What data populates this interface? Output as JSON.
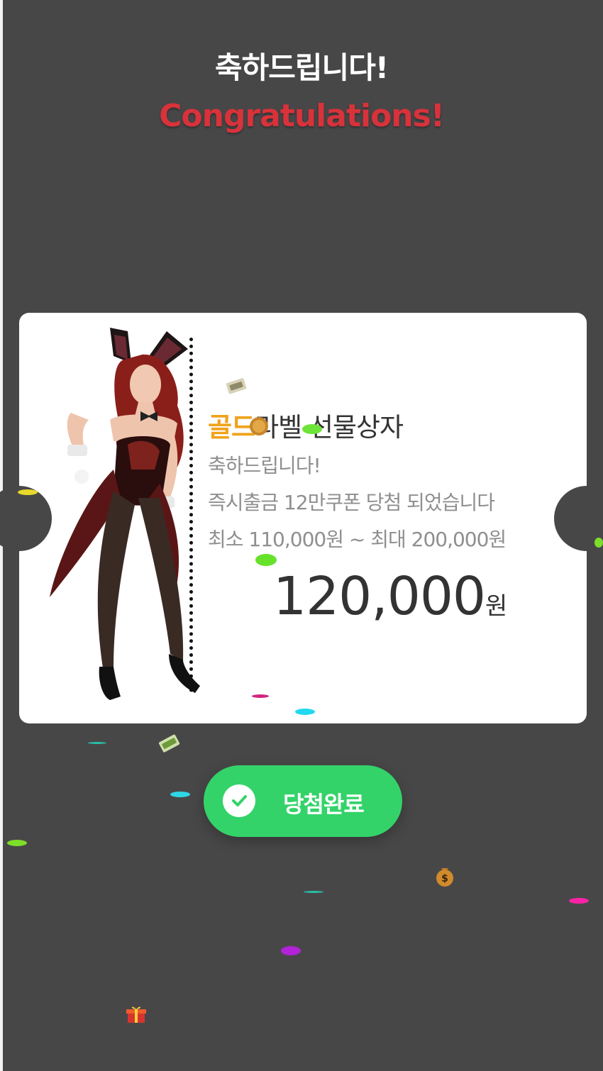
{
  "header": {
    "title_ko": "축하드립니다!",
    "title_en": "Congratulations!"
  },
  "ticket": {
    "title_gold": "골드",
    "title_rest": "라벨 선물상자",
    "line1": "축하드립니다!",
    "line2": "즉시출금 12만쿠폰 당첨 되었습니다",
    "line3": "최소 110,000원 ~ 최대 200,000원",
    "amount": "120,000",
    "amount_unit": "원"
  },
  "button": {
    "label": "당첨완료"
  },
  "colors": {
    "background": "#484748",
    "accent_red": "#d8323b",
    "gold": "#f0a31b",
    "button_green": "#33d36a"
  },
  "icons": [
    "check-icon",
    "money-bundle-icon",
    "money-bag-icon",
    "gift-box-icon",
    "coin-icon"
  ]
}
